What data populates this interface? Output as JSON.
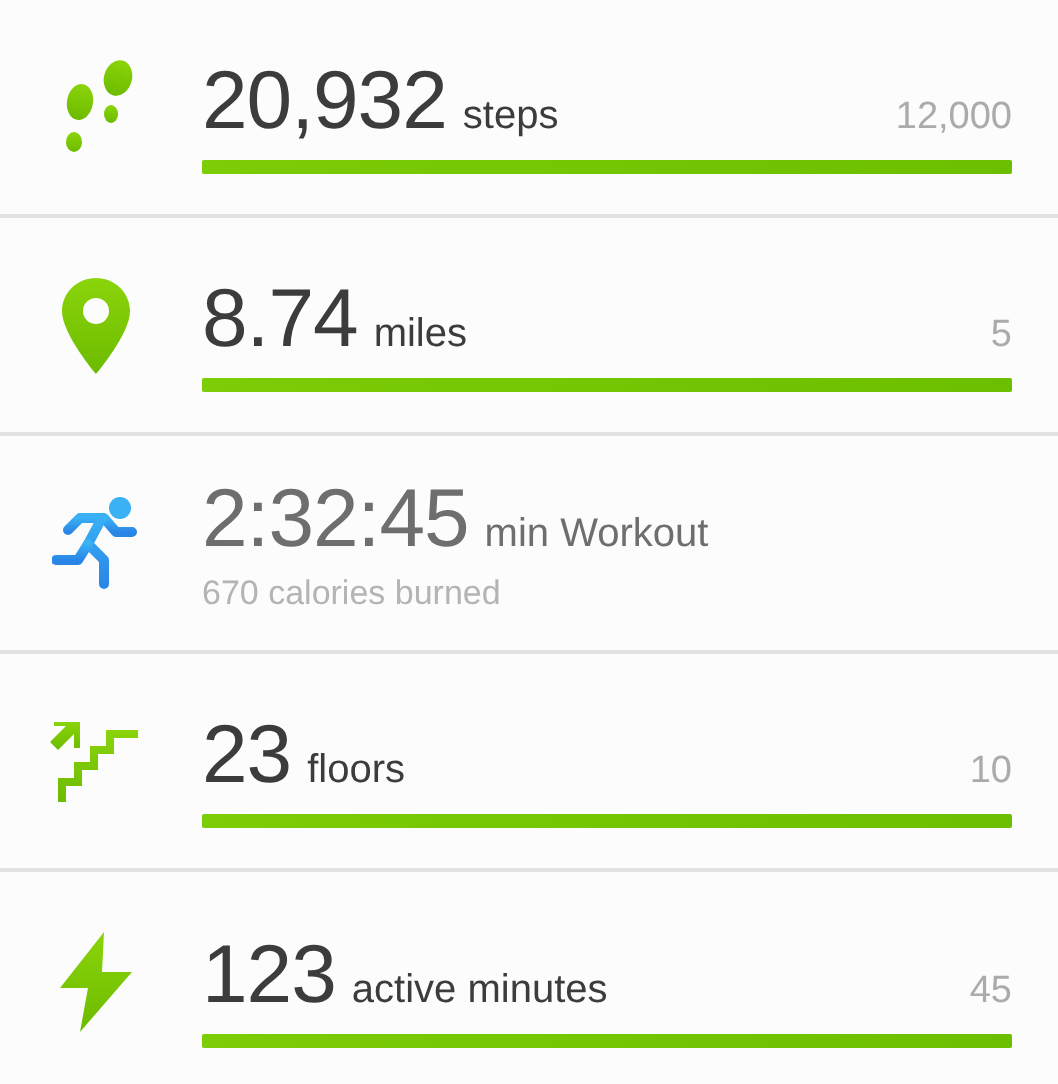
{
  "stats": [
    {
      "kind": "steps",
      "value": "20,932",
      "unit": "steps",
      "goal": "12,000",
      "level": 1
    },
    {
      "kind": "distance",
      "value": "8.74",
      "unit": "miles",
      "goal": "5",
      "level": 1
    },
    {
      "kind": "workout",
      "value": "2:32:45",
      "unit": "min Workout",
      "detail": "670 calories burned"
    },
    {
      "kind": "floors",
      "value": "23",
      "unit": "floors",
      "goal": "10",
      "level": 1
    },
    {
      "kind": "active",
      "value": "123",
      "unit": "active minutes",
      "goal": "45",
      "level": 1
    }
  ]
}
